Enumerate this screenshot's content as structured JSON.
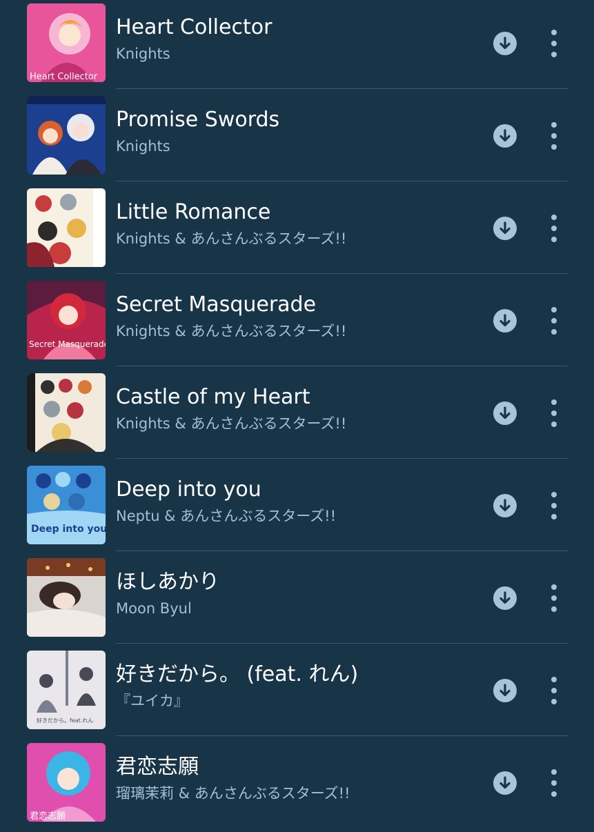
{
  "songs": [
    {
      "title": "Heart Collector",
      "artist": "Knights",
      "art_text": "Heart Collector",
      "colors": [
        "#e8559a",
        "#f7b6d3",
        "#c22f73"
      ]
    },
    {
      "title": "Promise Swords",
      "artist": "Knights",
      "art_text": "",
      "colors": [
        "#1d3f8f",
        "#e7e9ef",
        "#d8612f"
      ]
    },
    {
      "title": "Little Romance",
      "artist": "Knights & あんさんぶるスターズ!!",
      "art_text": "",
      "colors": [
        "#f6f1e3",
        "#c83c3c",
        "#e8b34a"
      ]
    },
    {
      "title": "Secret Masquerade",
      "artist": "Knights & あんさんぶるスターズ!!",
      "art_text": "Secret Masquerade",
      "colors": [
        "#b8244b",
        "#5b1c3e",
        "#f07a9d"
      ]
    },
    {
      "title": "Castle of my Heart",
      "artist": "Knights & あんさんぶるスターズ!!",
      "art_text": "",
      "colors": [
        "#f2ebdd",
        "#b8333f",
        "#30302e"
      ]
    },
    {
      "title": "Deep into you",
      "artist": "Neptu & あんさんぶるスターズ!!",
      "art_text": "Deep into you",
      "colors": [
        "#3a8fd6",
        "#9fd7f5",
        "#1d3f8f"
      ]
    },
    {
      "title": "ほしあかり",
      "artist": "Moon Byul",
      "art_text": "",
      "colors": [
        "#d9d4cf",
        "#3a2a25",
        "#f0ebe6"
      ]
    },
    {
      "title": "好きだから。 (feat. れん)",
      "artist": "『ユイカ』",
      "art_text": "好きだから。feat.れん",
      "colors": [
        "#e9e6ec",
        "#7c7f8d",
        "#4a4a57"
      ]
    },
    {
      "title": "君恋志願",
      "artist": "瑠璃茉莉 & あんさんぶるスターズ!!",
      "art_text": "君恋志願",
      "colors": [
        "#e04fae",
        "#3ab5e6",
        "#f39ad2"
      ]
    }
  ],
  "icons": {
    "download": "download-icon",
    "more": "more-vert-icon"
  },
  "colors": {
    "background": "#173547",
    "title": "#ffffff",
    "artist": "#9fc2d4",
    "icon": "#a6c5d9",
    "divider": "#3c5a6b"
  }
}
